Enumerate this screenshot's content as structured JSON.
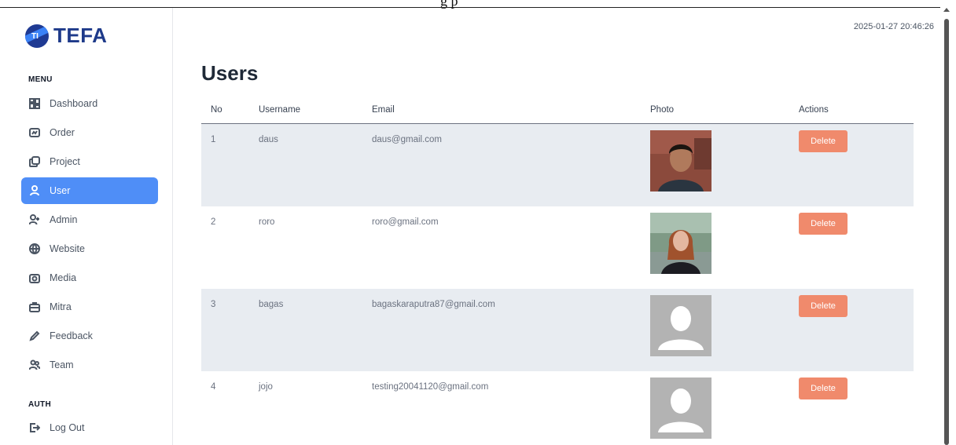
{
  "header_fragment": "g p",
  "app": {
    "logo_text": "TEFA",
    "logo_mark_text": "TI"
  },
  "timestamp": "2025-01-27 20:46:26",
  "sidebar": {
    "menu_label": "MENU",
    "items": [
      {
        "label": "Dashboard",
        "icon": "dashboard-icon"
      },
      {
        "label": "Order",
        "icon": "order-icon"
      },
      {
        "label": "Project",
        "icon": "project-icon"
      },
      {
        "label": "User",
        "icon": "user-icon",
        "active": true
      },
      {
        "label": "Admin",
        "icon": "admin-icon"
      },
      {
        "label": "Website",
        "icon": "globe-icon"
      },
      {
        "label": "Media",
        "icon": "camera-icon"
      },
      {
        "label": "Mitra",
        "icon": "briefcase-icon"
      },
      {
        "label": "Feedback",
        "icon": "pencil-icon"
      },
      {
        "label": "Team",
        "icon": "team-icon"
      }
    ],
    "auth_label": "AUTH",
    "auth_items": [
      {
        "label": "Log Out",
        "icon": "logout-icon"
      }
    ]
  },
  "page_title": "Users",
  "table": {
    "headers": [
      "No",
      "Username",
      "Email",
      "Photo",
      "Actions"
    ],
    "rows": [
      {
        "no": "1",
        "username": "daus",
        "email": "daus@gmail.com",
        "photo": "man-photo",
        "action": "Delete"
      },
      {
        "no": "2",
        "username": "roro",
        "email": "roro@gmail.com",
        "photo": "woman-photo",
        "action": "Delete"
      },
      {
        "no": "3",
        "username": "bagas",
        "email": "bagaskaraputra87@gmail.com",
        "photo": "default-avatar",
        "action": "Delete"
      },
      {
        "no": "4",
        "username": "jojo",
        "email": "testing20041120@gmail.com",
        "photo": "default-avatar",
        "action": "Delete"
      }
    ]
  },
  "colors": {
    "accent": "#4f8ef7",
    "delete": "#f08a6c",
    "row_shade": "#e8ecf1",
    "brand": "#1e3a8a"
  }
}
